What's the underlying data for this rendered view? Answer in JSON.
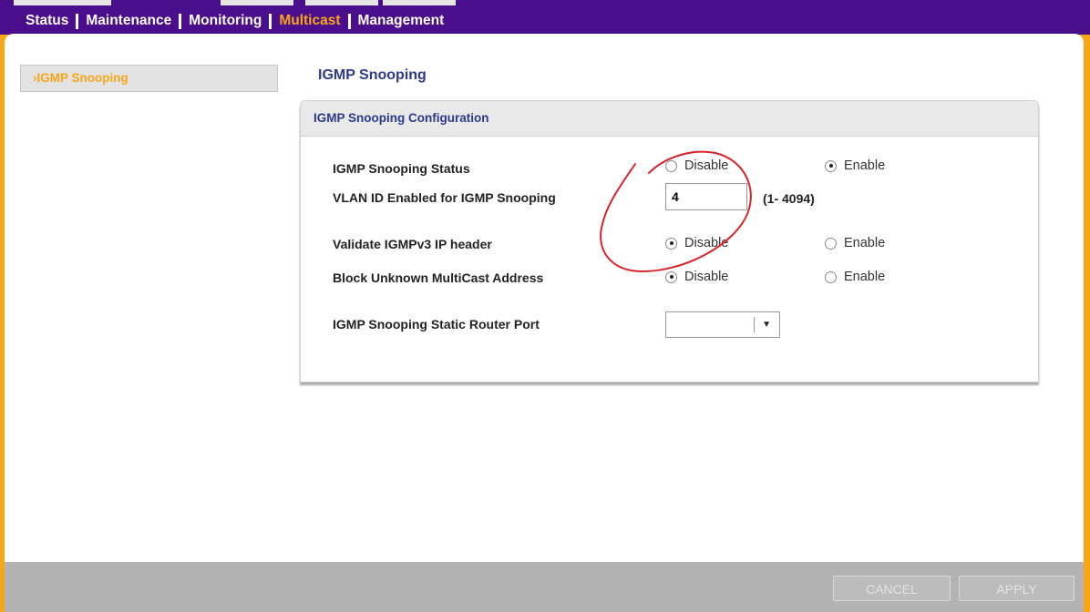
{
  "nav": {
    "items": [
      "Status",
      "Maintenance",
      "Monitoring",
      "Multicast",
      "Management"
    ],
    "active": "Multicast"
  },
  "sidebar": {
    "items": [
      {
        "label": "›IGMP Snooping"
      }
    ]
  },
  "page": {
    "title": "IGMP Snooping"
  },
  "config": {
    "header": "IGMP Snooping Configuration",
    "status": {
      "label": "IGMP Snooping Status",
      "options": [
        "Disable",
        "Enable"
      ],
      "selected": "Enable"
    },
    "vlan": {
      "label": "VLAN ID Enabled for IGMP Snooping",
      "value": "4",
      "range": "(1- 4094)"
    },
    "validate": {
      "label": "Validate IGMPv3 IP header",
      "options": [
        "Disable",
        "Enable"
      ],
      "selected": "Disable"
    },
    "block": {
      "label": "Block Unknown MultiCast Address",
      "options": [
        "Disable",
        "Enable"
      ],
      "selected": "Disable"
    },
    "router_port": {
      "label": "IGMP Snooping Static Router Port",
      "value": ""
    }
  },
  "buttons": {
    "cancel": "CANCEL",
    "apply": "APPLY"
  },
  "colors": {
    "brand_purple": "#4a0d8c",
    "accent_orange": "#f9a51a",
    "title_blue": "#2b3a8c",
    "annotation_red": "#d8232a"
  }
}
